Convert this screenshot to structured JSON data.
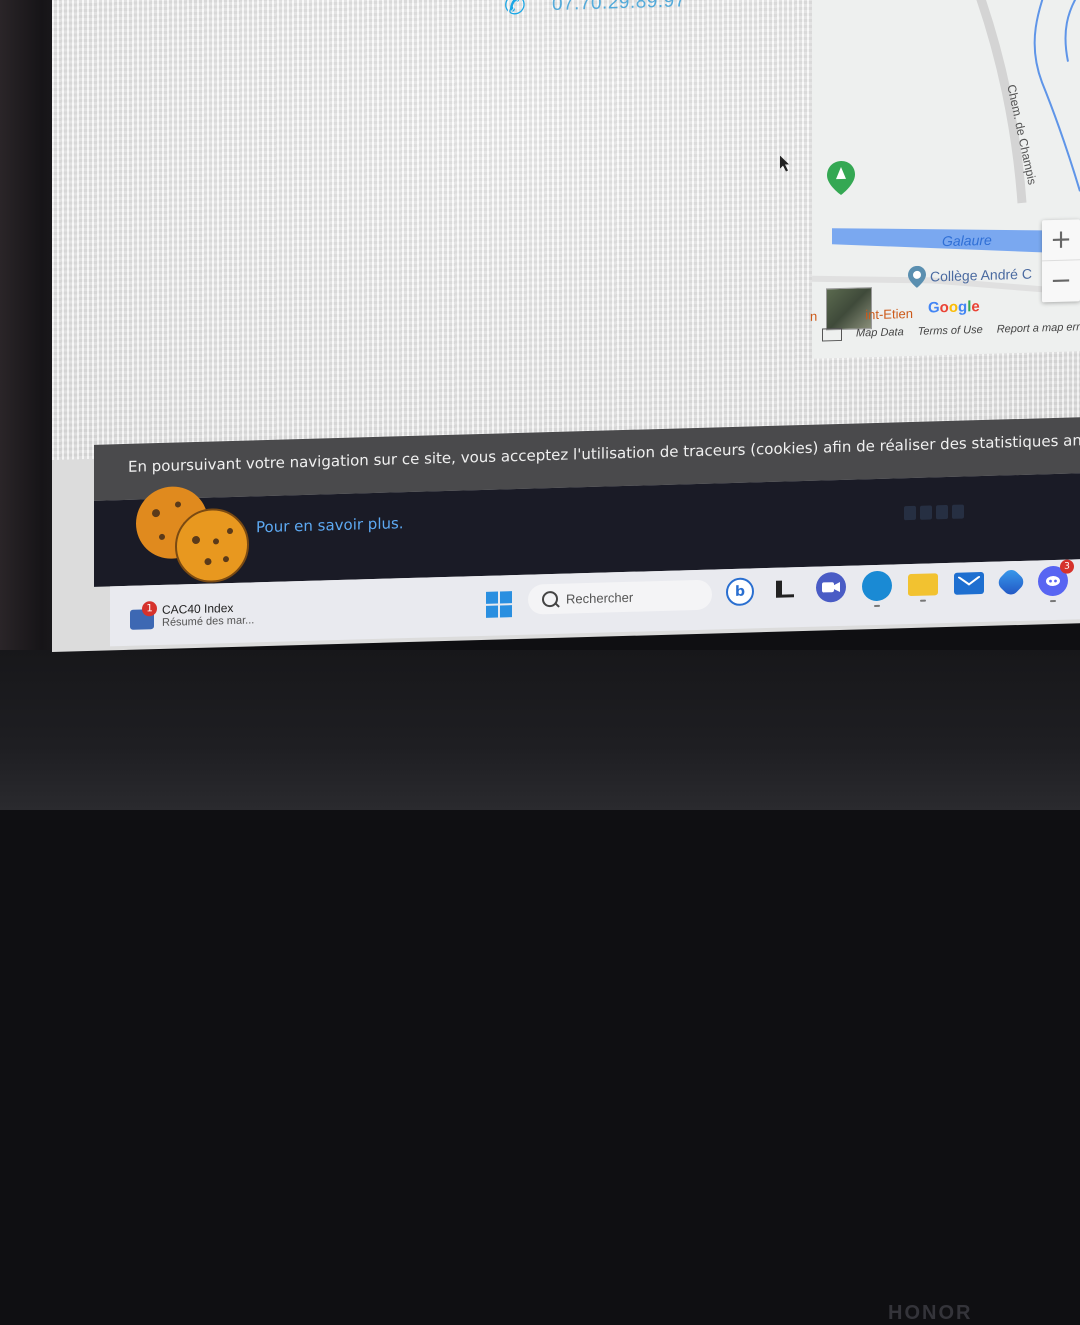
{
  "contact": {
    "phone_number": "07.70.29.89.97"
  },
  "map": {
    "road_label": "Chem. de Champis",
    "river_label": "Galaure",
    "poi_label": "Collège André C",
    "place_label_prefix": "n",
    "place_label": "int-Etien",
    "google_logo": "Google",
    "footer": {
      "map_data": "Map Data",
      "terms": "Terms of Use",
      "report": "Report a map erro"
    },
    "zoom_in": "+",
    "zoom_out": "−"
  },
  "cookie_banner": {
    "text": "En poursuivant votre navigation sur ce site, vous acceptez l'utilisation de traceurs (cookies) afin de réaliser des statistiques anonyme",
    "learn_more": "Pour en savoir plus."
  },
  "taskbar": {
    "news_title": "CAC40 Index",
    "news_subtitle": "Résumé des mar...",
    "news_badge": "1",
    "search_placeholder": "Rechercher",
    "discord_badge": "3",
    "apps": [
      "bing-icon",
      "terminal-icon",
      "teams-icon",
      "edge-icon",
      "file-explorer-icon",
      "mail-icon",
      "copilot-icon",
      "discord-icon"
    ]
  },
  "device": {
    "brand": "HONOR"
  },
  "colors": {
    "accent": "#1aa7e6",
    "river": "#4a8fe6",
    "cookie_bar": "#4a4a4c",
    "link": "#5da9f2"
  }
}
